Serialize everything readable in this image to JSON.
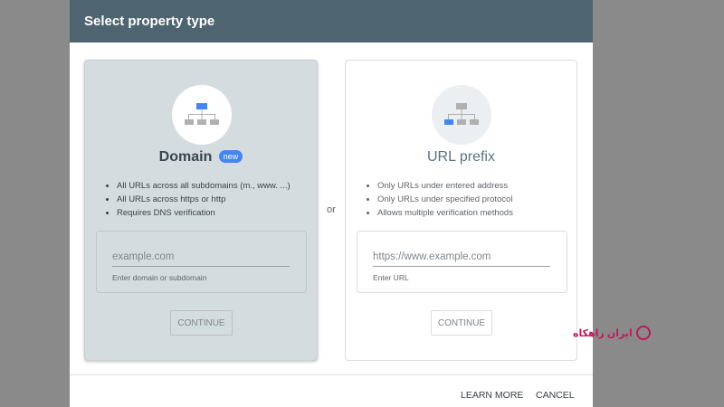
{
  "dialog": {
    "title": "Select property type",
    "separator": "or",
    "footer": {
      "learn_more": "LEARN MORE",
      "cancel": "CANCEL"
    }
  },
  "cards": [
    {
      "title": "Domain",
      "badge": "new",
      "icon": "sitemap-icon",
      "features": [
        "All URLs across all subdomains (m., www. ...)",
        "All URLs across https or http",
        "Requires DNS verification"
      ],
      "input_placeholder": "example.com",
      "input_value": "",
      "helper": "Enter domain or subdomain",
      "button": "CONTINUE"
    },
    {
      "title": "URL prefix",
      "icon": "sitemap-icon",
      "features": [
        "Only URLs under entered address",
        "Only URLs under specified protocol",
        "Allows multiple verification methods"
      ],
      "input_placeholder": "https://www.example.com",
      "input_value": "",
      "helper": "Enter URL",
      "button": "CONTINUE"
    }
  ],
  "watermark": {
    "text": "ایران راهکاه"
  },
  "colors": {
    "header_bg": "#4e6470",
    "domain_card_bg": "#d5dce0",
    "badge": "#4285f4",
    "icon_blue": "#4285f4",
    "icon_gray": "#b0b0b0",
    "watermark": "#c2185b"
  }
}
